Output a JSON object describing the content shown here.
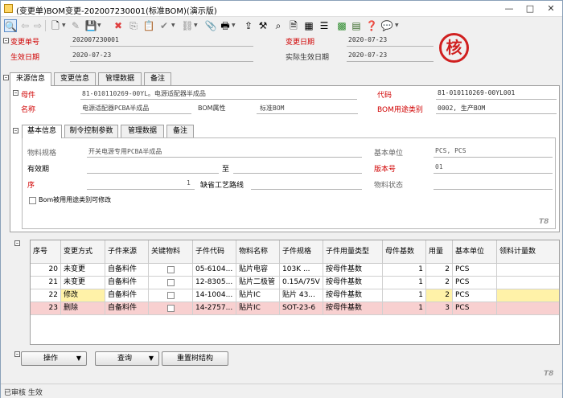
{
  "window": {
    "title": "(变更单)BOM变更-202007230001(标准BOM)(演示版)",
    "minimize": "—",
    "maximize": "□",
    "close": "✕"
  },
  "header": {
    "change_no_label": "变更单号",
    "change_no": "202007230001",
    "change_date_label": "变更日期",
    "change_date": "2020-07-23",
    "effective_date_label": "生效日期",
    "effective_date": "2020-07-23",
    "actual_effective_label": "实际生效日期",
    "actual_effective": "2020-07-23",
    "stamp": "核"
  },
  "outer_tabs": [
    "来源信息",
    "变更信息",
    "管理数据",
    "备注"
  ],
  "source": {
    "parent_label": "母件",
    "parent": "81-010110269-00YL。电源适配器半成品",
    "code_label": "代码",
    "code": "81-010110269-00YL001",
    "name_label": "名称",
    "name": "电源适配器PCBA半成品",
    "bom_attr_label": "BOM属性",
    "bom_attr": "标准BOM",
    "bom_usage_label": "BOM用途类别",
    "bom_usage": "0002, 生产BOM"
  },
  "inner_tabs": [
    "基本信息",
    "制令控制参数",
    "管理数据",
    "备注"
  ],
  "basic": {
    "spec_label": "物料规格",
    "spec": "开关电源专用PCBA半成品",
    "unit_label": "基本单位",
    "unit": "PCS, PCS",
    "validity_label": "有效期",
    "to_label": "至",
    "version_label": "版本号",
    "version": "01",
    "seq_label": "序",
    "seq": "1",
    "route_label": "缺省工艺路线",
    "status_label": "物料状态",
    "allow_label": "Bom被用用途类别可修改",
    "watermark": "T8"
  },
  "grid": {
    "columns": [
      "序号",
      "变更方式",
      "子件来源",
      "关键物料",
      "子件代码",
      "物料名称",
      "子件规格",
      "子件用量类型",
      "母件基数",
      "用量",
      "基本单位",
      "领料计量数"
    ],
    "rows": [
      {
        "seq": "20",
        "mode": "未变更",
        "source": "自备料件",
        "code": "05-6104...",
        "name": "贴片电容",
        "spec": "103K  ...",
        "type": "按母件基数",
        "base": "1",
        "qty": "2",
        "unit": "PCS",
        "issue": ""
      },
      {
        "seq": "21",
        "mode": "未变更",
        "source": "自备料件",
        "code": "12-8305...",
        "name": "贴片二极管",
        "spec": "0.15A/75V",
        "type": "按母件基数",
        "base": "1",
        "qty": "2",
        "unit": "PCS",
        "issue": ""
      },
      {
        "seq": "22",
        "mode": "修改",
        "source": "自备料件",
        "code": "14-1004...",
        "name": "贴片IC",
        "spec": "贴片 43...",
        "type": "按母件基数",
        "base": "1",
        "qty": "2",
        "unit": "PCS",
        "issue": ""
      },
      {
        "seq": "23",
        "mode": "删除",
        "source": "自备料件",
        "code": "14-2757...",
        "name": "贴片IC",
        "spec": "SOT-23-6",
        "type": "按母件基数",
        "base": "1",
        "qty": "3",
        "unit": "PCS",
        "issue": ""
      }
    ]
  },
  "buttons": {
    "operate": "操作",
    "query": "查询",
    "rebuild": "重置树结构",
    "dropdown": "▼"
  },
  "footer_watermark": "T8",
  "status_bar": {
    "text": "已审核  生效"
  },
  "colors": {
    "modified": "#fff2a8",
    "deleted": "#f8d0d0",
    "red_label": "#d00000"
  }
}
